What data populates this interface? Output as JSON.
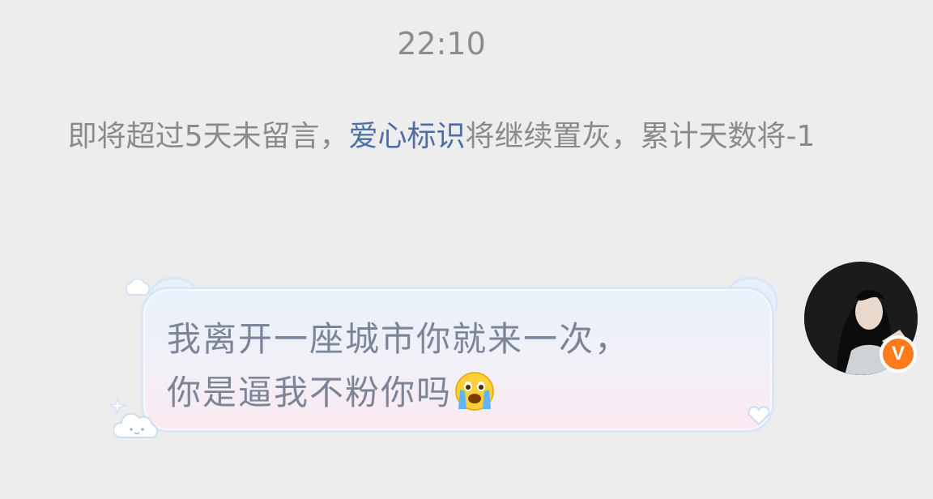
{
  "chat": {
    "timestamp": "22:10",
    "notice": {
      "prefix": "即将超过5天未留言，",
      "link": "爱心标识",
      "suffix": "将继续置灰，累计天数将-1"
    },
    "message": {
      "line1": "我离开一座城市你就来一次，",
      "line2": "你是逼我不粉你吗",
      "emoji": "loudly-crying-face-icon"
    },
    "sender": {
      "avatar": "user-avatar",
      "badge": "V"
    }
  },
  "colors": {
    "background": "#ededed",
    "link": "#4d6fa3",
    "badge": "#ff7a1a",
    "bubble_text": "#7b8597"
  }
}
